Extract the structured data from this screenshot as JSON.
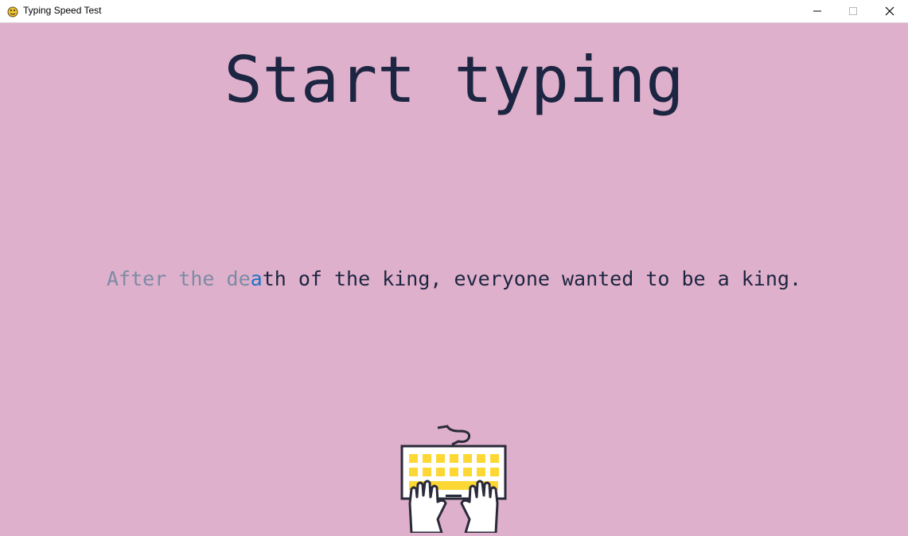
{
  "window": {
    "title": "Typing Speed Test",
    "icon": "pygame-snake-icon",
    "controls": [
      "minimize-icon",
      "maximize-icon",
      "close-icon"
    ]
  },
  "main": {
    "heading": "Start typing",
    "sentence": {
      "typed": "After the de",
      "current": "a",
      "remaining": "th of the king, everyone wanted to be a king."
    },
    "illustration": "keyboard-with-hands-icon"
  },
  "colors": {
    "background": "#dfb0cb",
    "heading": "#1c2541",
    "typed_text": "#7d8aa6",
    "current_char": "#1a73c9",
    "remaining_text": "#1c2541",
    "keys": "#fdd835"
  }
}
